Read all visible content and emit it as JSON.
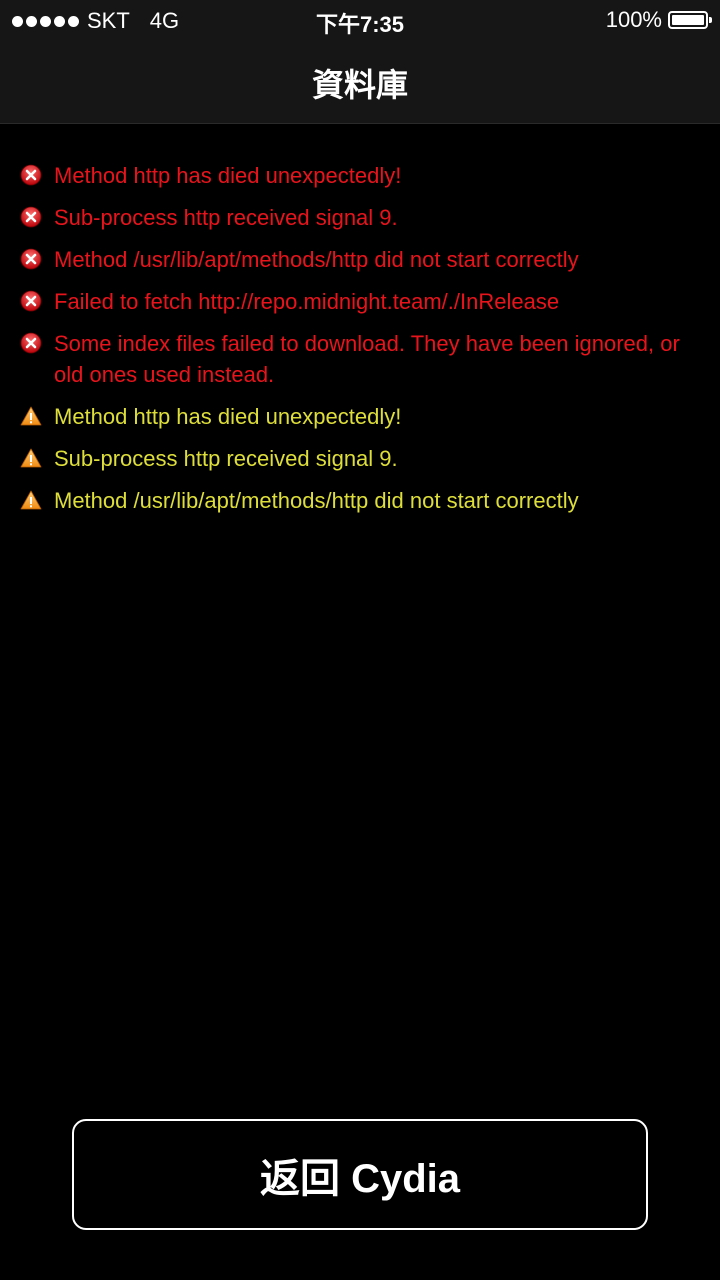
{
  "status_bar": {
    "carrier": "SKT",
    "network": "4G",
    "time": "下午7:35",
    "battery_percent": "100%",
    "signal_bars": 5
  },
  "nav": {
    "title": "資料庫"
  },
  "messages": [
    {
      "type": "error",
      "icon": "error-x-icon",
      "text": "Method http has died unexpectedly!"
    },
    {
      "type": "error",
      "icon": "error-x-icon",
      "text": "Sub-process http received signal 9."
    },
    {
      "type": "error",
      "icon": "error-x-icon",
      "text": "Method /usr/lib/apt/methods/http did not start correctly"
    },
    {
      "type": "error",
      "icon": "error-x-icon",
      "text": "Failed to fetch http://repo.midnight.team/./InRelease"
    },
    {
      "type": "error",
      "icon": "error-x-icon",
      "text": "Some index files failed to download. They have been ignored, or old ones used instead."
    },
    {
      "type": "warning",
      "icon": "warning-triangle-icon",
      "text": "Method http has died unexpectedly!"
    },
    {
      "type": "warning",
      "icon": "warning-triangle-icon",
      "text": "Sub-process http received signal 9."
    },
    {
      "type": "warning",
      "icon": "warning-triangle-icon",
      "text": "Method /usr/lib/apt/methods/http did not start correctly"
    }
  ],
  "actions": {
    "return_label": "返回 Cydia"
  },
  "colors": {
    "error": "#e8141c",
    "warning": "#dede3a",
    "background": "#000000",
    "bar": "#161616"
  }
}
